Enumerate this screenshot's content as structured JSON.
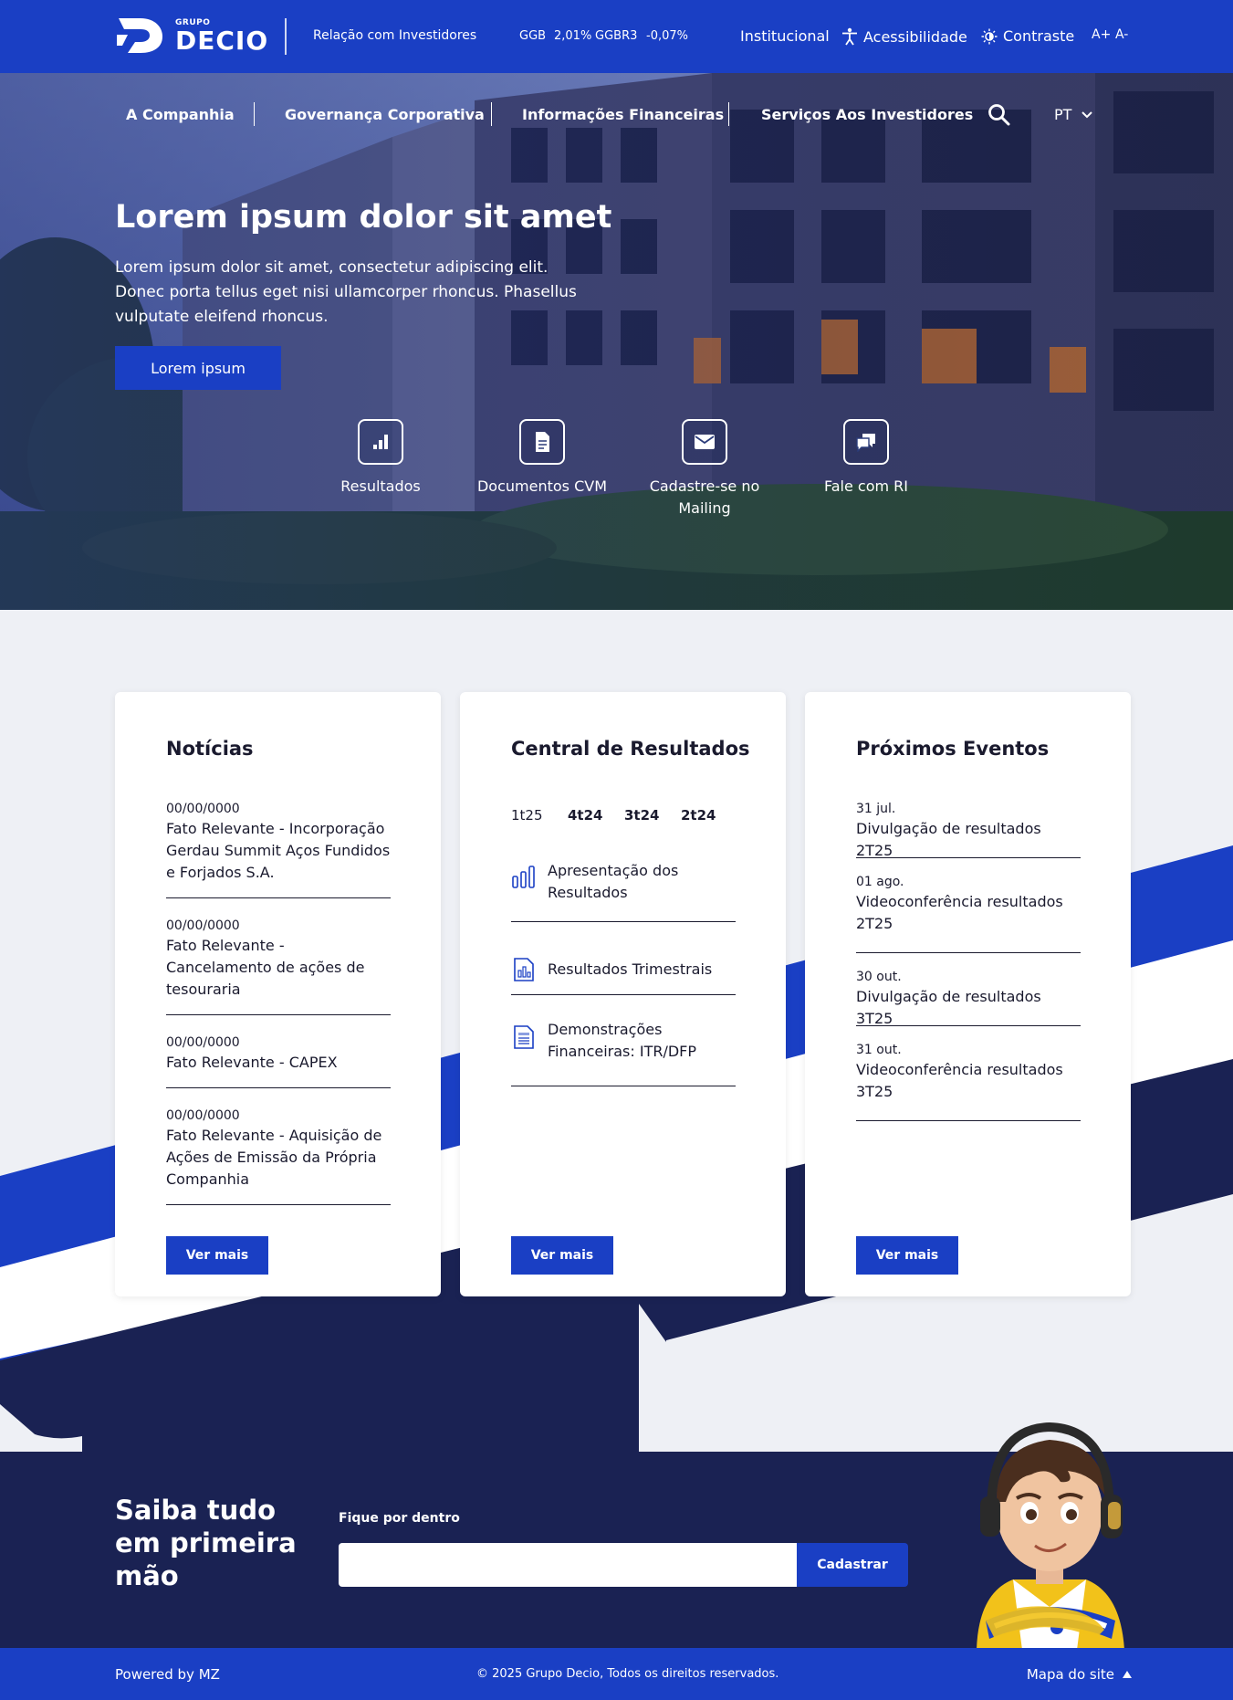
{
  "topbar": {
    "logo_sub": "GRUPO",
    "logo_name": "DECIO",
    "ri_label": "Relação com Investidores",
    "tickers": [
      {
        "symbol": "GGB",
        "change": "2,01%"
      },
      {
        "symbol": "GGBR3",
        "change": "-0,07%"
      }
    ],
    "links": {
      "institucional": "Institucional",
      "acessibilidade": "Acessibilidade",
      "contraste": "Contraste",
      "font_increase": "A+",
      "font_decrease": "A-"
    }
  },
  "nav": {
    "items": [
      "A Companhia",
      "Governança Corporativa",
      "Informações Financeiras",
      "Serviços Aos Investidores"
    ],
    "language": "PT"
  },
  "hero": {
    "title": "Lorem ipsum dolor sit amet",
    "text": "Lorem ipsum dolor sit amet, consectetur adipiscing elit. Donec porta tellus eget nisi ullamcorper rhoncus. Phasellus vulputate eleifend rhoncus.",
    "button": "Lorem ipsum",
    "shortcuts": [
      {
        "label": "Resultados",
        "icon": "bar-chart-icon"
      },
      {
        "label": "Documentos CVM",
        "icon": "document-icon"
      },
      {
        "label": "Cadastre-se no Mailing",
        "icon": "envelope-icon"
      },
      {
        "label": "Fale com RI",
        "icon": "chat-icon"
      }
    ]
  },
  "noticias": {
    "title": "Notícias",
    "items": [
      {
        "date": "00/00/0000",
        "text": "Fato Relevante - Incorporação Gerdau Summit Aços Fundidos e Forjados S.A."
      },
      {
        "date": "00/00/0000",
        "text": "Fato Relevante - Cancelamento de ações de tesouraria"
      },
      {
        "date": "00/00/0000",
        "text": "Fato Relevante - CAPEX"
      },
      {
        "date": "00/00/0000",
        "text": "Fato Relevante - Aquisição de Ações de Emissão da Própria Companhia"
      }
    ],
    "button": "Ver mais"
  },
  "resultados": {
    "title": "Central de Resultados",
    "quarters": [
      "1t25",
      "4t24",
      "3t24",
      "2t24"
    ],
    "items": [
      {
        "label": "Apresentação dos Resultados",
        "icon": "bar-chart-icon"
      },
      {
        "label": "Resultados Trimestrais",
        "icon": "report-chart-icon"
      },
      {
        "label": "Demonstrações Financeiras: ITR/DFP",
        "icon": "spreadsheet-icon"
      }
    ],
    "button": "Ver mais"
  },
  "eventos": {
    "title": "Próximos Eventos",
    "items": [
      {
        "date": "31 jul.",
        "text": "Divulgação de resultados 2T25"
      },
      {
        "date": "01 ago.",
        "text": "Videoconferência resultados 2T25"
      },
      {
        "date": "30 out.",
        "text": "Divulgação de resultados 3T25"
      },
      {
        "date": "31 out.",
        "text": "Videoconferência resultados 3T25"
      }
    ],
    "button": "Ver mais"
  },
  "newsletter": {
    "title": "Saiba tudo em primeira mão",
    "label": "Fique por dentro",
    "input_value": "",
    "button": "Cadastrar"
  },
  "footer": {
    "powered": "Powered by MZ",
    "copyright": "© 2025 Grupo Decio, Todos os direitos reservados.",
    "sitemap": "Mapa do site"
  },
  "colors": {
    "brand_blue": "#1a3fc4",
    "navy": "#1a2253",
    "background": "#eef0f5"
  }
}
